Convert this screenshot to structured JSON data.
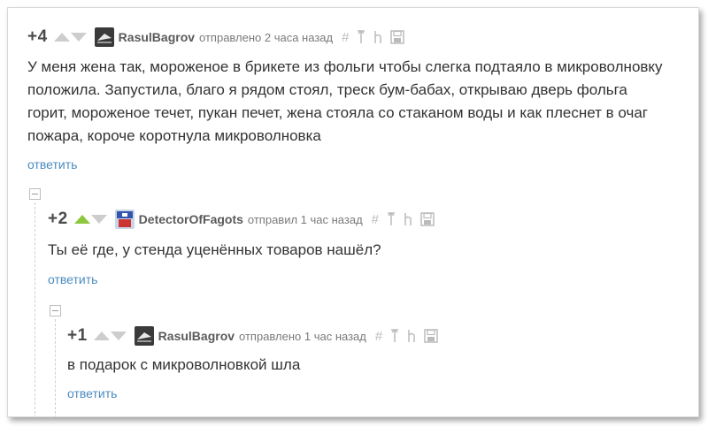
{
  "comments": [
    {
      "rating": "+4",
      "author": "RasulBagrov",
      "meta": "отправлено 2 часа назад",
      "text": "У меня жена так, мороженое в брикете из фольги чтобы слегка подтаяло в микроволновку положила. Запустила, благо я рядом стоял, треск бум-бабах, открываю дверь фольга горит, мороженое течет, пукан печет, жена стояла со стаканом воды и как плеснет в очаг пожара, короче коротнула микроволновка",
      "reply": "ответить"
    },
    {
      "rating": "+2",
      "author": "DetectorOfFagots",
      "meta": "отправил 1 час назад",
      "text": "Ты её где, у стенда уценённых товаров нашёл?",
      "reply": "ответить"
    },
    {
      "rating": "+1",
      "author": "RasulBagrov",
      "meta": "отправлено 1 час назад",
      "text": "в подарок с микроволновкой шла",
      "reply": "ответить"
    }
  ],
  "icons": {
    "hash": "#",
    "vote_up_color": "#8dc63f",
    "vote_neutral_color": "#cdcdcd",
    "link_color": "#4c8bbf"
  }
}
